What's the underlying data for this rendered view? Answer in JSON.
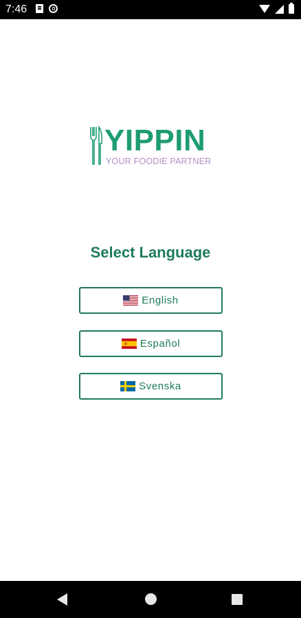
{
  "status_bar": {
    "time": "7:46",
    "left_icons": [
      "document-icon",
      "at-sign-icon"
    ],
    "right_icons": [
      "wifi-icon",
      "signal-icon",
      "battery-icon"
    ]
  },
  "logo": {
    "title": "YIPPIN",
    "tagline": "YOUR FOODIE PARTNER",
    "icon": "fork-knife-icon",
    "title_color": "#1e9c74",
    "tagline_color": "#b28fc3"
  },
  "main": {
    "title": "Select Language",
    "languages": [
      {
        "label": "English",
        "flag": "us-flag-icon"
      },
      {
        "label": "Español",
        "flag": "spain-flag-icon"
      },
      {
        "label": "Svenska",
        "flag": "sweden-flag-icon"
      }
    ]
  },
  "nav_bar": {
    "buttons": [
      "back-icon",
      "home-icon",
      "recents-icon"
    ]
  },
  "colors": {
    "accent": "#1e7a5e",
    "background": "#ffffff"
  }
}
